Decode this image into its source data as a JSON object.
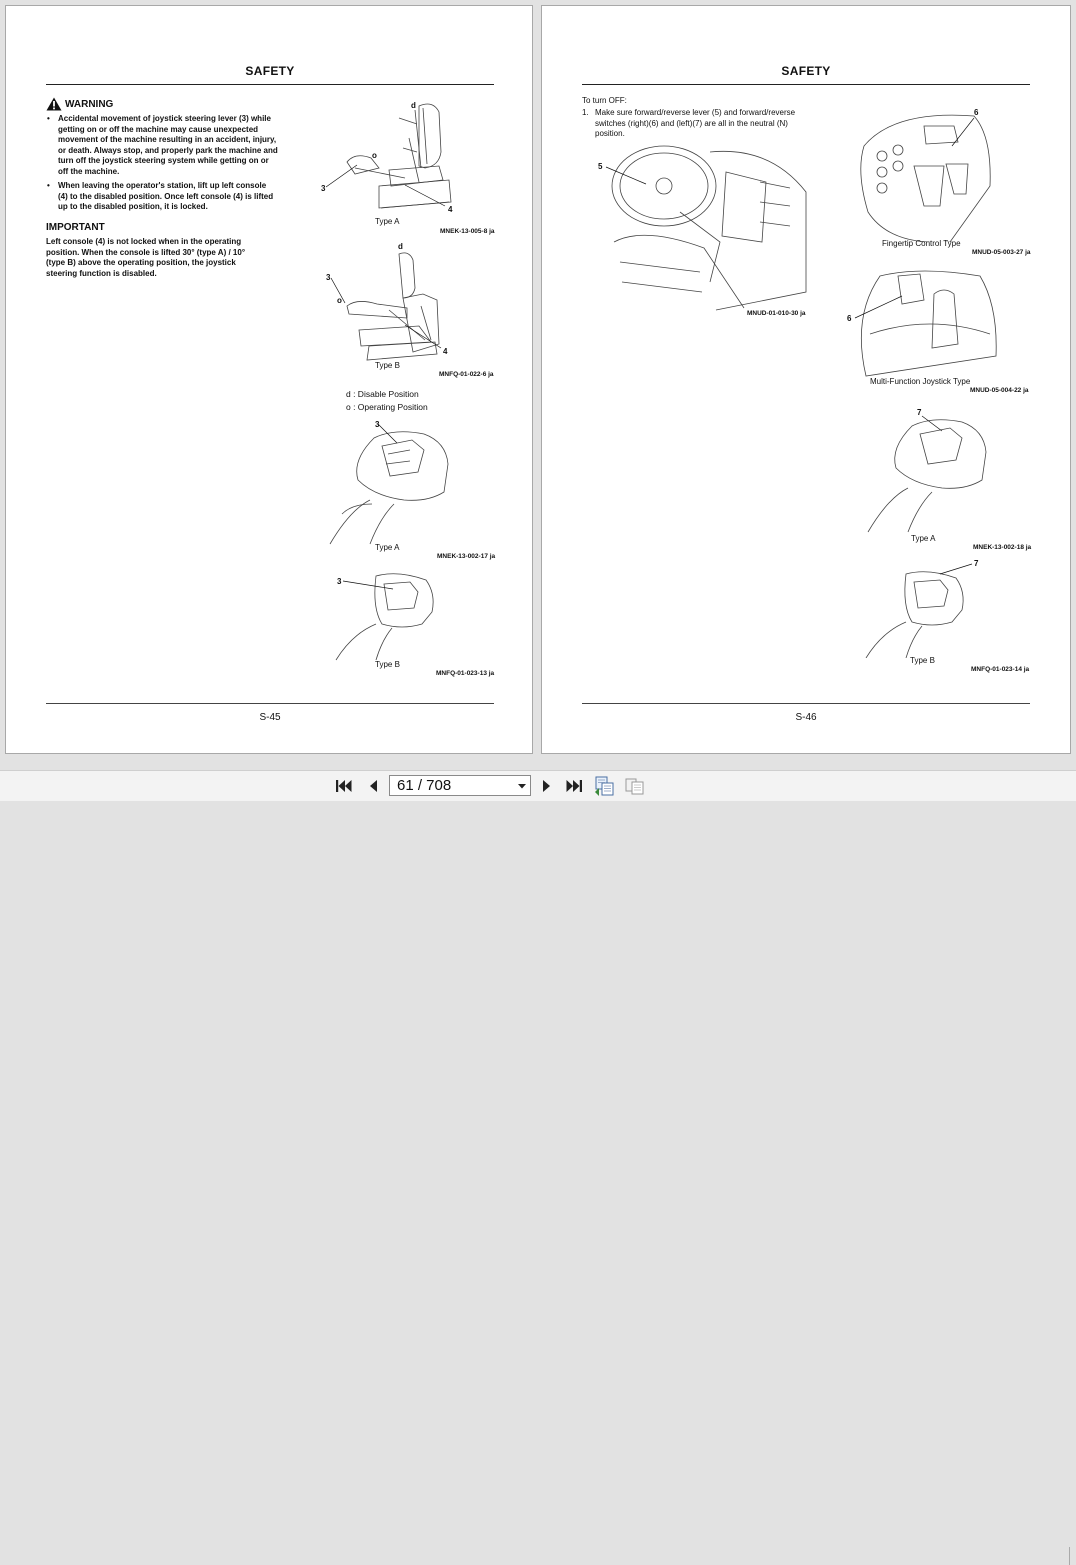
{
  "left_page": {
    "header": "SAFETY",
    "footer": "S-45",
    "warning": {
      "title": "WARNING",
      "bullets": [
        "Accidental movement of joystick steering lever (3) while getting on or off the machine may cause unexpected movement of the machine resulting in an accident, injury, or death. Always stop, and properly park the machine and turn off the joystick steering system while getting on or off the machine.",
        "When leaving the operator's station, lift up left console (4) to the disabled position. Once left console (4) is lifted up to the disabled position, it is locked."
      ]
    },
    "important": {
      "title": "IMPORTANT",
      "text": "Left console (4) is not locked when in the operating position. When the console is lifted 30° (type A) / 10° (type B) above the operating position, the joystick steering function is disabled."
    },
    "figures": [
      {
        "caption": "Type A",
        "ref": "MNEK-13-005-8 ja",
        "labels": [
          "d",
          "o",
          "3",
          "4"
        ]
      },
      {
        "caption": "Type B",
        "ref": "MNFQ-01-022-6 ja",
        "labels": [
          "d",
          "3",
          "o",
          "4"
        ]
      },
      {
        "caption": "Type A",
        "ref": "MNEK-13-002-17 ja",
        "labels": [
          "3"
        ]
      },
      {
        "caption": "Type B",
        "ref": "MNFQ-01-023-13 ja",
        "labels": [
          "3"
        ]
      }
    ],
    "legend": [
      "d : Disable Position",
      "o : Operating Position"
    ]
  },
  "right_page": {
    "header": "SAFETY",
    "footer": "S-46",
    "intro": "To turn OFF:",
    "step_number": "1.",
    "step_text": "Make sure forward/reverse lever (5) and forward/reverse switches (right)(6) and (left)(7) are all in the neutral (N) position.",
    "figures": [
      {
        "caption": "",
        "ref": "MNUD-01-010-30 ja",
        "labels": [
          "5"
        ]
      },
      {
        "caption": "Fingertip Control Type",
        "ref": "MNUD-05-003-27 ja",
        "labels": [
          "6"
        ]
      },
      {
        "caption": "Multi-Function Joystick Type",
        "ref": "MNUD-05-004-22 ja",
        "labels": [
          "6"
        ]
      },
      {
        "caption": "Type A",
        "ref": "MNEK-13-002-18 ja",
        "labels": [
          "7"
        ]
      },
      {
        "caption": "Type B",
        "ref": "MNFQ-01-023-14 ja",
        "labels": [
          "7"
        ]
      }
    ]
  },
  "toolbar": {
    "page_value": "61 / 708",
    "icons": {
      "first": "first-page-icon",
      "prev": "previous-page-icon",
      "next": "next-page-icon",
      "last": "last-page-icon",
      "view_a": "continuous-view-icon",
      "view_b": "facing-pages-icon",
      "dropdown": "chevron-down-icon"
    }
  }
}
